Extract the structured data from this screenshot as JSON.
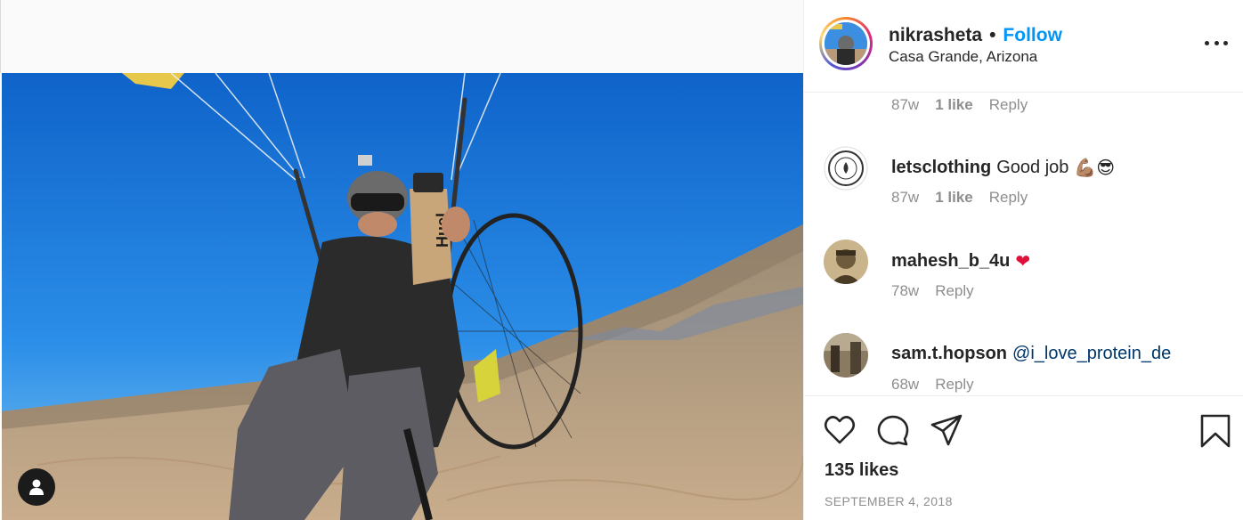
{
  "post": {
    "username": "nikrasheta",
    "separator": "•",
    "follow_label": "Follow",
    "location": "Casa Grande, Arizona",
    "image_alt_brand": "Huel",
    "likes_text": "135 likes",
    "date": "SEPTEMBER 4, 2018"
  },
  "comments": [
    {
      "username": "",
      "text": "",
      "age": "87w",
      "likes": "1 like",
      "reply": "Reply"
    },
    {
      "username": "letsclothing",
      "text": "Good job",
      "emoji": "💪🏽😎",
      "age": "87w",
      "likes": "1 like",
      "reply": "Reply",
      "avatar_text": "LETS CLOTHING HANDCRAFTED"
    },
    {
      "username": "mahesh_b_4u",
      "text": "",
      "emoji": "❤",
      "age": "78w",
      "reply": "Reply"
    },
    {
      "username": "sam.t.hopson",
      "mention": "@i_love_protein_de",
      "age": "68w",
      "reply": "Reply"
    }
  ],
  "icons": {
    "like": "heart-icon",
    "comment": "comment-icon",
    "share": "share-icon",
    "save": "bookmark-icon",
    "more": "more-options-icon",
    "user_tag": "user-tag-icon"
  },
  "colors": {
    "follow": "#0095f6",
    "mention": "#00376b",
    "meta": "#8e8e8e",
    "heart": "#e0103a"
  }
}
